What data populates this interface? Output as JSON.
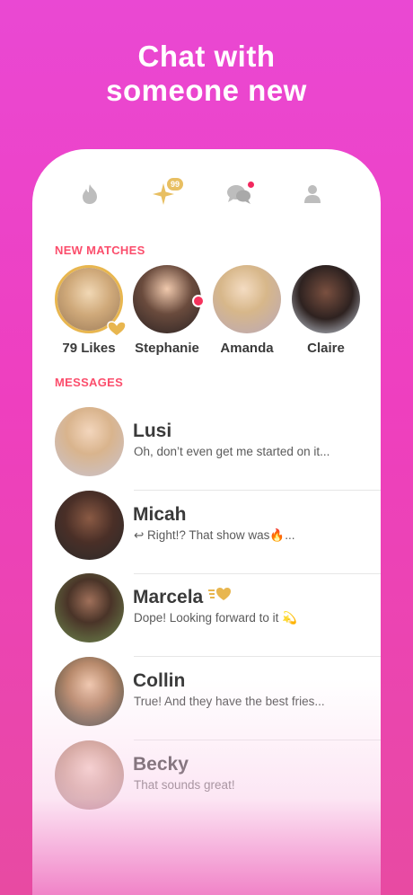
{
  "headline": {
    "line1": "Chat with",
    "line2": "someone new"
  },
  "tabs": [
    {
      "icon": "flame-icon"
    },
    {
      "icon": "sparkle-icon",
      "badge": "99"
    },
    {
      "icon": "chat-bubbles-icon",
      "has_dot": true
    },
    {
      "icon": "profile-icon"
    }
  ],
  "sections": {
    "new_matches": "NEW MATCHES",
    "messages": "MESSAGES"
  },
  "matches": [
    {
      "name": "79 Likes"
    },
    {
      "name": "Stephanie"
    },
    {
      "name": "Amanda"
    },
    {
      "name": "Claire"
    }
  ],
  "messages": [
    {
      "name": "Lusi",
      "preview": "Oh, don’t even get me started on it..."
    },
    {
      "name": "Micah",
      "preview": "↩ Right!? That show was🔥..."
    },
    {
      "name": "Marcela",
      "preview": "Dope! Looking forward to it 💫"
    },
    {
      "name": "Collin",
      "preview": "True! And they have the best fries..."
    },
    {
      "name": "Becky",
      "preview": "That sounds great!"
    }
  ],
  "colors": {
    "accent_red": "#fb4e6c",
    "gold": "#e8b64f",
    "background": "#ee3fbf"
  }
}
